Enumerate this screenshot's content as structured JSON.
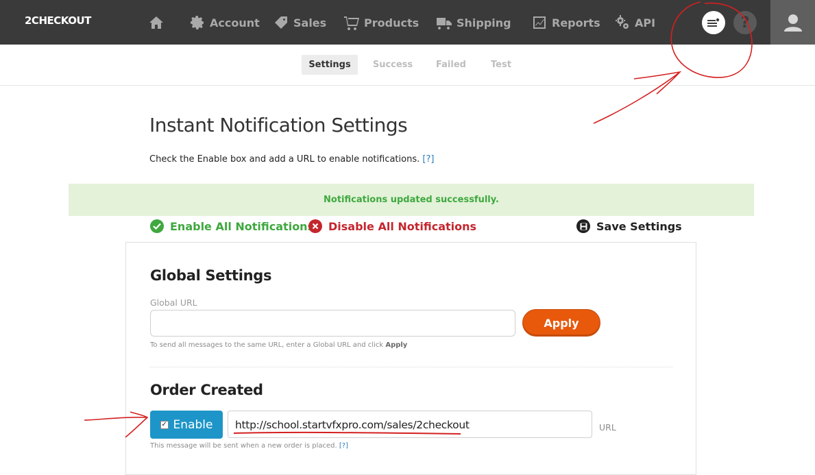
{
  "brand": {
    "logo_text": "2CHECKOUT"
  },
  "topnav": {
    "items": [
      {
        "label": "",
        "icon": "home-icon"
      },
      {
        "label": "Account",
        "icon": "gear-icon"
      },
      {
        "label": "Sales",
        "icon": "tag-icon"
      },
      {
        "label": "Products",
        "icon": "cart-icon"
      },
      {
        "label": "Shipping",
        "icon": "truck-icon"
      },
      {
        "label": "Reports",
        "icon": "chart-icon"
      },
      {
        "label": "API",
        "icon": "gears-icon"
      }
    ],
    "help_label": "?"
  },
  "subnav": {
    "tabs": [
      {
        "label": "Settings",
        "active": true
      },
      {
        "label": "Success",
        "active": false
      },
      {
        "label": "Failed",
        "active": false
      },
      {
        "label": "Test",
        "active": false
      }
    ]
  },
  "page": {
    "title": "Instant Notification Settings",
    "intro": "Check the Enable box and add a URL to enable notifications.",
    "help_link": "[?]"
  },
  "alert": {
    "message": "Notifications updated successfully."
  },
  "actions": {
    "enable_all": "Enable All Notifications",
    "disable_all": "Disable All Notifications",
    "save": "Save Settings"
  },
  "global": {
    "heading": "Global Settings",
    "url_label": "Global URL",
    "url_value": "",
    "apply_label": "Apply",
    "hint_prefix": "To send all messages to the same URL, enter a Global URL and click",
    "hint_bold": "Apply"
  },
  "order_created": {
    "heading": "Order Created",
    "enable_label": "Enable",
    "enabled": true,
    "url_value": "http://school.startvfxpro.com/sales/2checkout",
    "url_label": "URL",
    "hint": "This message will be sent when a new order is placed.",
    "help_link": "[?]"
  },
  "colors": {
    "topnav_bg": "#3a3a3a",
    "success_green": "#3fa83f",
    "danger_red": "#c4262e",
    "apply_orange": "#e8590c",
    "enable_blue": "#1e95c8",
    "annotation_red": "#d42020"
  }
}
